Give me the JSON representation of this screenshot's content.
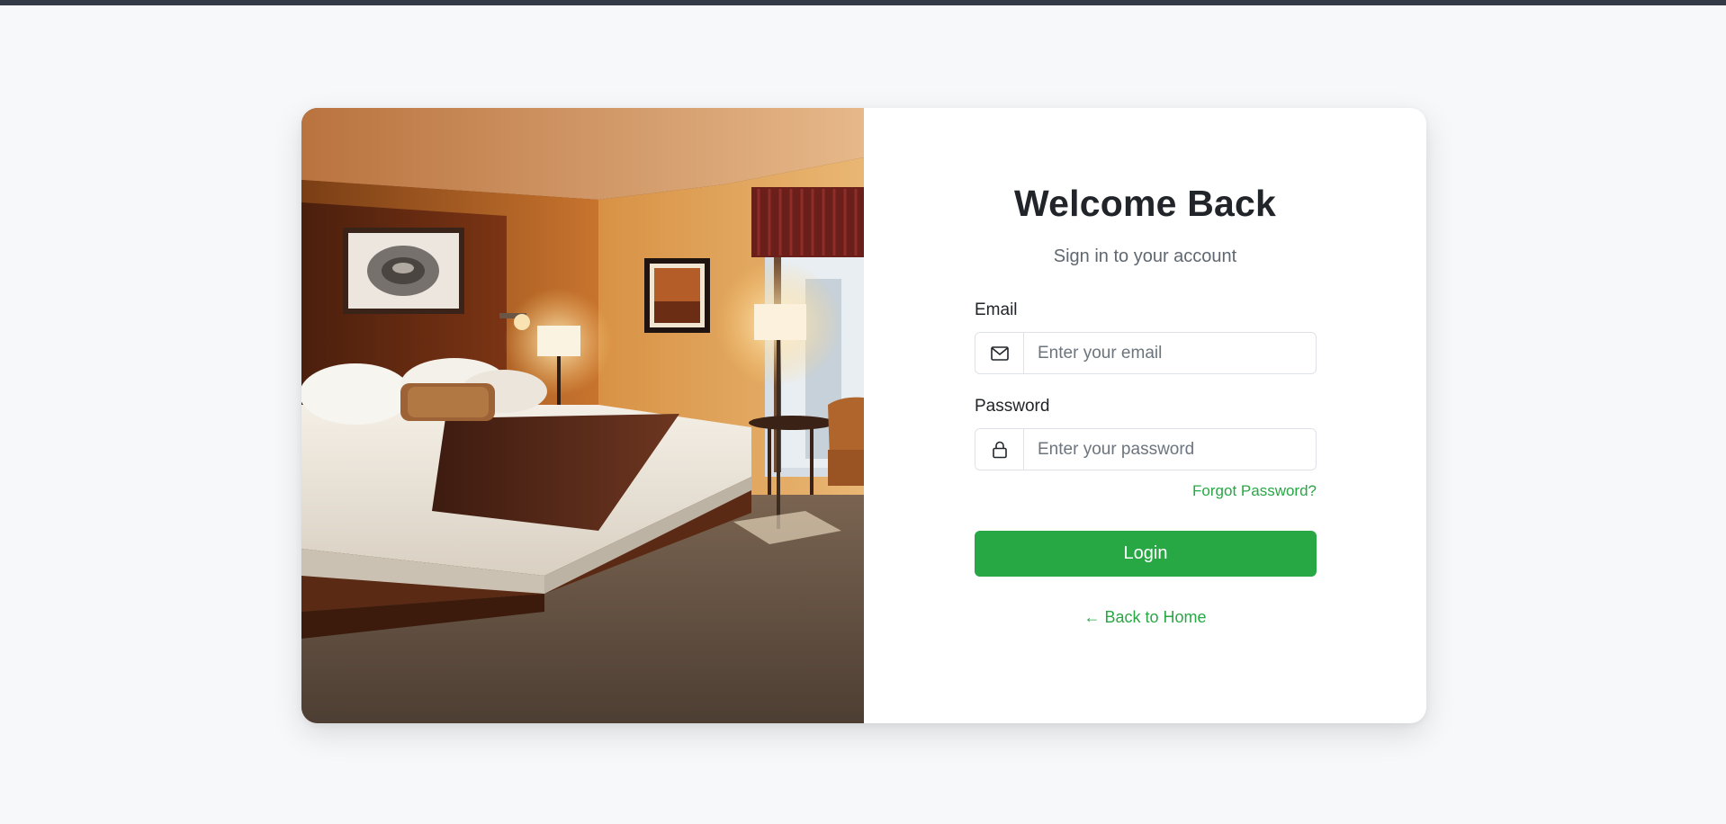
{
  "login": {
    "title": "Welcome Back",
    "subtitle": "Sign in to your account",
    "email_label": "Email",
    "email_placeholder": "Enter your email",
    "email_icon": "envelope-icon",
    "password_label": "Password",
    "password_placeholder": "Enter your password",
    "password_icon": "lock-icon",
    "forgot_password": "Forgot Password?",
    "login_button": "Login",
    "back_link": "← Back to Home"
  },
  "hero_image": {
    "subject": "hotel-room-photo"
  },
  "colors": {
    "accent": "#28a745",
    "top_bar": "#343a46",
    "background": "#f7f8fa",
    "title_text": "#212529",
    "muted_text": "#5f6770"
  }
}
